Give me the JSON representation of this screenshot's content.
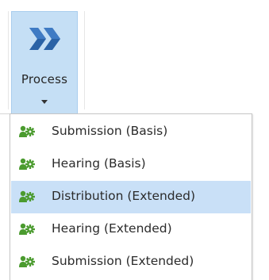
{
  "ribbon": {
    "process_button": {
      "label": "Process",
      "icon": "double-chevron-right-icon",
      "has_dropdown": true
    }
  },
  "dropdown": {
    "icon": "process-gear-icon",
    "highlighted_index": 2,
    "items": [
      {
        "label": "Submission (Basis)"
      },
      {
        "label": "Hearing (Basis)"
      },
      {
        "label": "Distribution (Extended)"
      },
      {
        "label": "Hearing (Extended)"
      },
      {
        "label": "Submission (Extended)"
      }
    ]
  },
  "colors": {
    "button_bg": "#c5dff5",
    "highlight_bg": "#c9e0f7",
    "chevron_blue": "#2a62a6",
    "icon_green": "#4b9b2f"
  }
}
